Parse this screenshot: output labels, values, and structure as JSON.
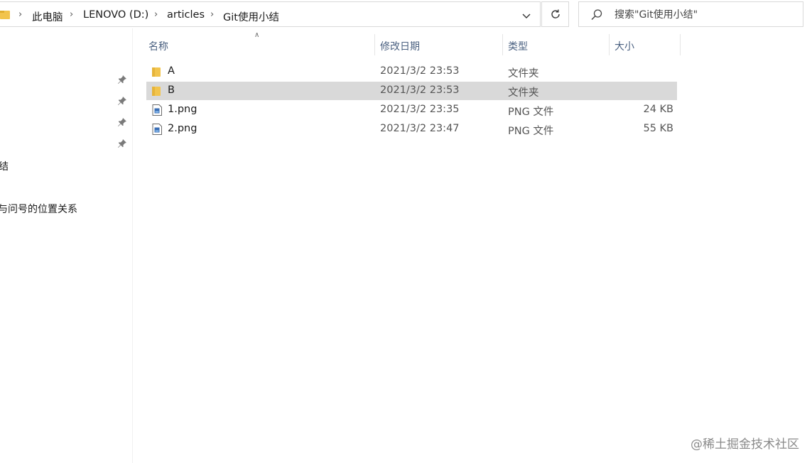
{
  "address_bar": {
    "breadcrumbs": [
      "此电脑",
      "LENOVO (D:)",
      "articles",
      "Git使用小结"
    ]
  },
  "search": {
    "placeholder": "搜索\"Git使用小结\""
  },
  "nav_pane": {
    "items": [
      "结",
      "与问号的位置关系"
    ]
  },
  "columns": {
    "name": "名称",
    "date": "修改日期",
    "type": "类型",
    "size": "大小"
  },
  "files": [
    {
      "name": "A",
      "date": "2021/3/2 23:53",
      "type": "文件夹",
      "size": "",
      "icon": "folder-icon"
    },
    {
      "name": "B",
      "date": "2021/3/2 23:53",
      "type": "文件夹",
      "size": "",
      "icon": "folder-icon"
    },
    {
      "name": "1.png",
      "date": "2021/3/2 23:35",
      "type": "PNG 文件",
      "size": "24 KB",
      "icon": "png-file-icon"
    },
    {
      "name": "2.png",
      "date": "2021/3/2 23:47",
      "type": "PNG 文件",
      "size": "55 KB",
      "icon": "png-file-icon"
    }
  ],
  "watermark": "@稀土掘金技术社区",
  "colors": {
    "folder": "#f2c44d",
    "selection": "#d9d9d9",
    "header_text": "#4a6080"
  }
}
